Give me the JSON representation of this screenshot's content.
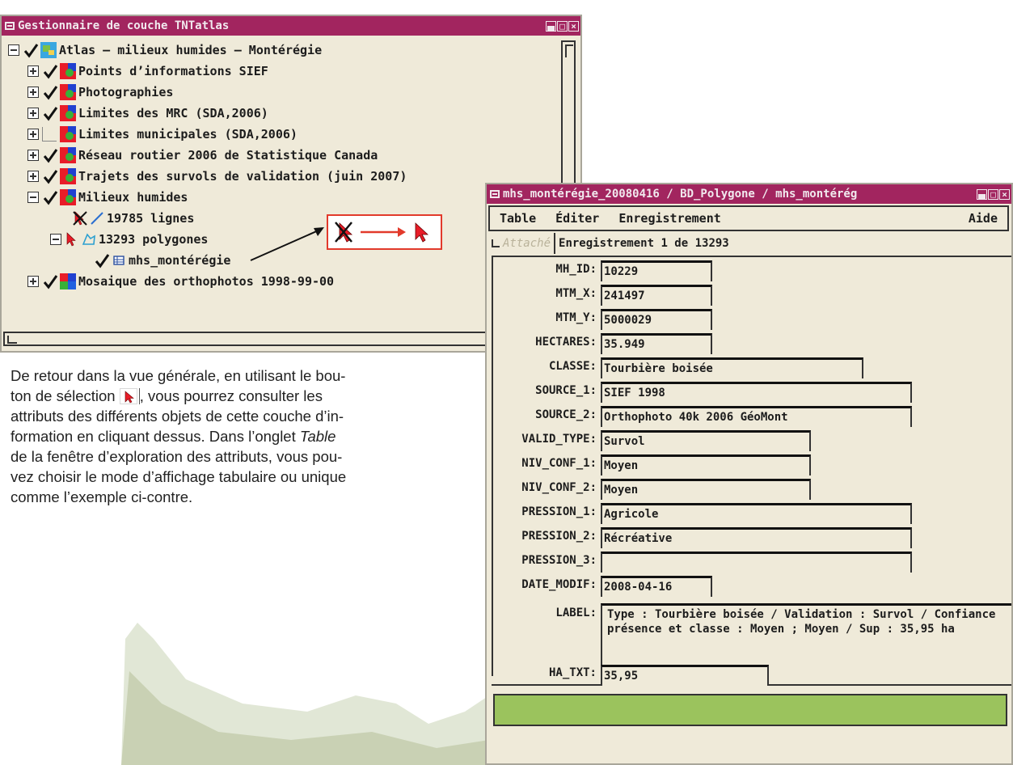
{
  "layer_manager": {
    "title": "Gestionnaire de couche TNTatlas",
    "items": [
      {
        "label": "Atlas – milieux humides – Montérégie"
      },
      {
        "label": "Points d’informations SIEF"
      },
      {
        "label": "Photographies"
      },
      {
        "label": "Limites des MRC (SDA,2006)"
      },
      {
        "label": "Limites municipales (SDA,2006)"
      },
      {
        "label": "Réseau routier 2006 de Statistique Canada"
      },
      {
        "label": "Trajets des survols de validation (juin 2007)"
      },
      {
        "label": "Milieux humides"
      },
      {
        "label": "19785 lignes"
      },
      {
        "label": "13293 polygones"
      },
      {
        "label": "mhs_montérégie"
      },
      {
        "label": "Mosaique des orthophotos 1998-99-00"
      }
    ]
  },
  "attribute_window": {
    "title": "mhs_montérégie_20080416 / BD_Polygone / mhs_montérég",
    "menu": [
      "Table",
      "Éditer",
      "Enregistrement",
      "Aide"
    ],
    "attache_label": "Attaché",
    "record_label": "Enregistrement 1 de 13293",
    "fields": [
      {
        "label": "MH_ID:",
        "value": "10229"
      },
      {
        "label": "MTM_X:",
        "value": "241497"
      },
      {
        "label": "MTM_Y:",
        "value": "5000029"
      },
      {
        "label": "HECTARES:",
        "value": "35.949"
      },
      {
        "label": "CLASSE:",
        "value": "Tourbière boisée"
      },
      {
        "label": "SOURCE_1:",
        "value": "SIEF 1998"
      },
      {
        "label": "SOURCE_2:",
        "value": "Orthophoto 40k 2006 GéoMont"
      },
      {
        "label": "VALID_TYPE:",
        "value": "Survol"
      },
      {
        "label": "NIV_CONF_1:",
        "value": "Moyen"
      },
      {
        "label": "NIV_CONF_2:",
        "value": "Moyen"
      },
      {
        "label": "PRESSION_1:",
        "value": "Agricole"
      },
      {
        "label": "PRESSION_2:",
        "value": "Récréative"
      },
      {
        "label": "PRESSION_3:",
        "value": ""
      },
      {
        "label": "DATE_MODIF:",
        "value": "2008-04-16"
      }
    ],
    "label_field": {
      "label": "LABEL:",
      "value": "Type : Tourbière boisée / Validation : Survol / Confiance présence et classe : Moyen ; Moyen / Sup : 35,95 ha"
    },
    "ha_field": {
      "label": "HA_TXT:",
      "value": "35,95"
    }
  },
  "paragraph": {
    "line1_before": "De retour dans la vue générale, en utilisant le bou-",
    "line2_before": "ton de sélection",
    "line2_after": ", vous pourrez consulter les",
    "line3": "attributs des différents objets de cette couche d’in-",
    "line4": "formation en cliquant dessus. Dans l’onglet",
    "line4_em": "Table",
    "line5": "de la fenêtre d’exploration des attributs, vous pou-",
    "line6": "vez choisir le mode d’affichage tabulaire ou unique",
    "line7": "comme l’exemple ci-contre."
  },
  "colors": {
    "titlebar": "#a2255f",
    "window_bg": "#efead9",
    "annotation": "#e23a2b",
    "status_bar": "#9bc35d"
  }
}
